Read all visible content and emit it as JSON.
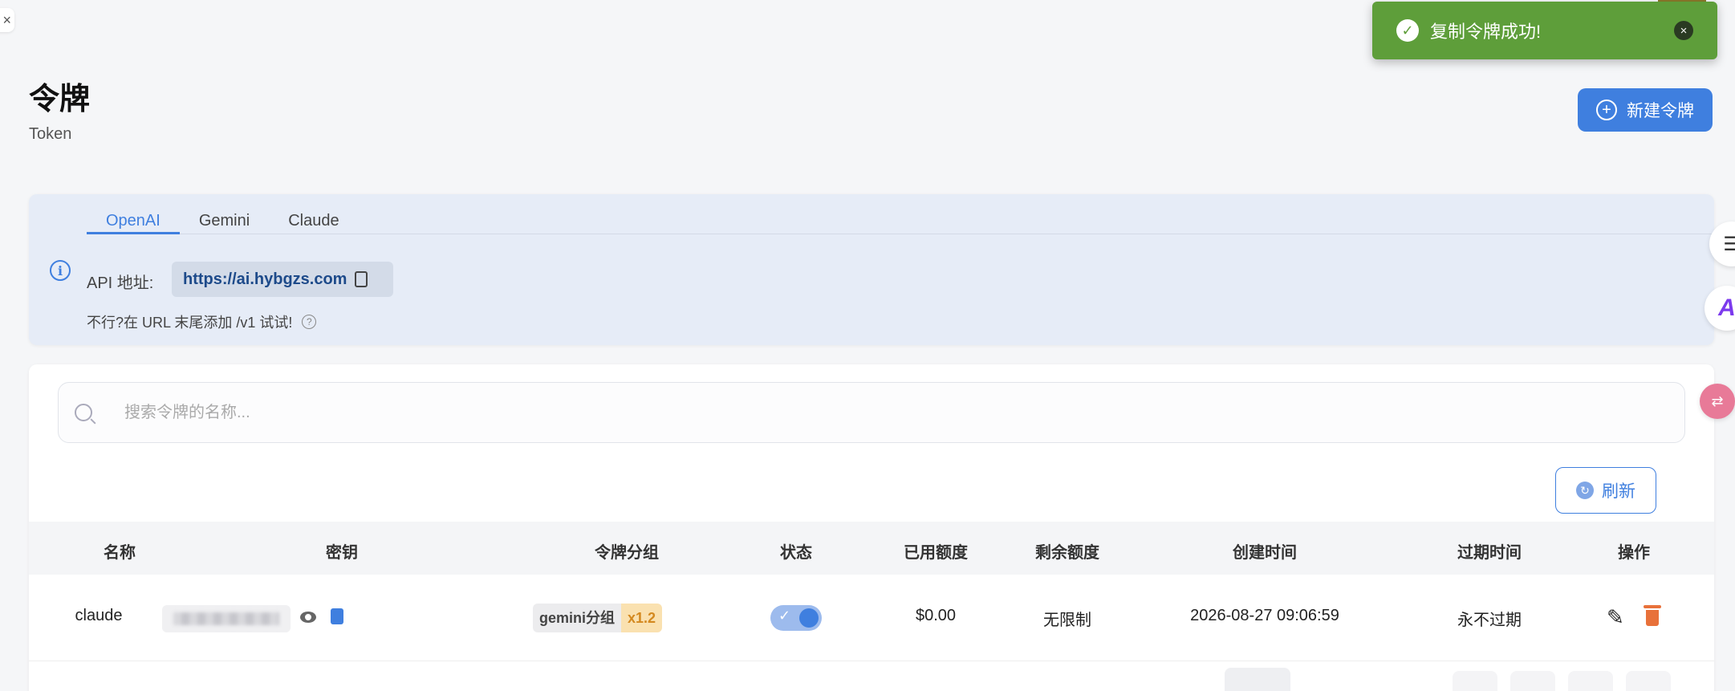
{
  "page": {
    "title": "令牌",
    "subtitle": "Token",
    "new_button_label": "新建令牌"
  },
  "toast": {
    "message": "复制令牌成功!"
  },
  "api_panel": {
    "tabs": [
      "OpenAI",
      "Gemini",
      "Claude"
    ],
    "active_tab": "OpenAI",
    "address_label": "API 地址:",
    "address_value": "https://ai.hybgzs.com",
    "hint": "不行?在 URL 末尾添加 /v1 试试!"
  },
  "search": {
    "placeholder": "搜索令牌的名称..."
  },
  "refresh_label": "刷新",
  "table": {
    "columns": [
      "名称",
      "密钥",
      "令牌分组",
      "状态",
      "已用额度",
      "剩余额度",
      "创建时间",
      "过期时间",
      "操作"
    ],
    "rows": [
      {
        "name": "claude",
        "group": "gemini分组",
        "multiplier": "x1.2",
        "status_enabled": true,
        "used_quota": "$0.00",
        "remaining_quota": "无限制",
        "created_at": "2026-08-27 09:06:59",
        "expires": "永不过期"
      }
    ]
  },
  "colors": {
    "primary": "#3f7fdf",
    "toast_success": "#5e9e3a",
    "multiplier_text": "#d4891f",
    "delete": "#e8713a"
  },
  "icons": [
    "check-circle-icon",
    "close-icon",
    "plus-circle-icon",
    "info-icon",
    "copy-icon",
    "help-icon",
    "search-icon",
    "refresh-icon",
    "eye-icon",
    "edit-icon",
    "delete-icon",
    "chat-icon",
    "ai-icon",
    "translate-icon"
  ]
}
